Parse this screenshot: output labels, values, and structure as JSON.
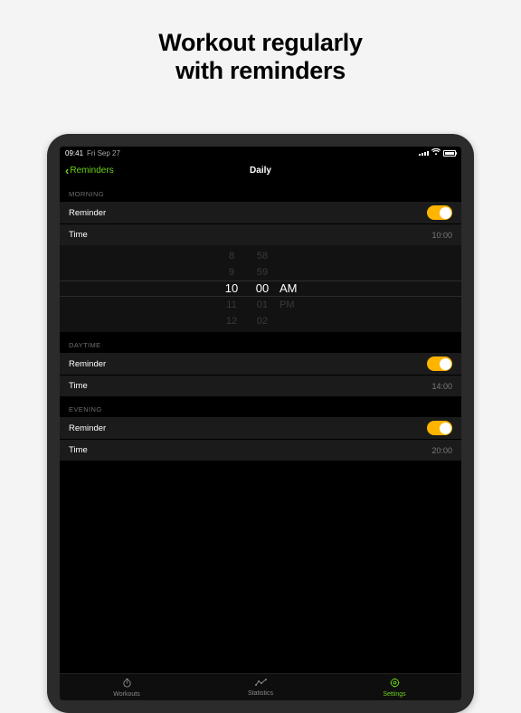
{
  "promo": {
    "line1": "Workout regularly",
    "line2": "with reminders"
  },
  "statusbar": {
    "time": "09:41",
    "date": "Fri Sep 27"
  },
  "nav": {
    "back": "Reminders",
    "title": "Daily"
  },
  "sections": {
    "morning": {
      "header": "MORNING",
      "reminder_label": "Reminder",
      "time_label": "Time",
      "time_value": "10:00"
    },
    "daytime": {
      "header": "DAYTIME",
      "reminder_label": "Reminder",
      "time_label": "Time",
      "time_value": "14:00"
    },
    "evening": {
      "header": "EVENING",
      "reminder_label": "Reminder",
      "time_label": "Time",
      "time_value": "20:00"
    }
  },
  "picker": {
    "hours": [
      "8",
      "9",
      "10",
      "11",
      "12"
    ],
    "minutes": [
      "58",
      "59",
      "00",
      "01",
      "02"
    ],
    "ampm": [
      "AM",
      "PM"
    ]
  },
  "tabs": {
    "workouts": "Workouts",
    "statistics": "Statistics",
    "settings": "Settings"
  }
}
